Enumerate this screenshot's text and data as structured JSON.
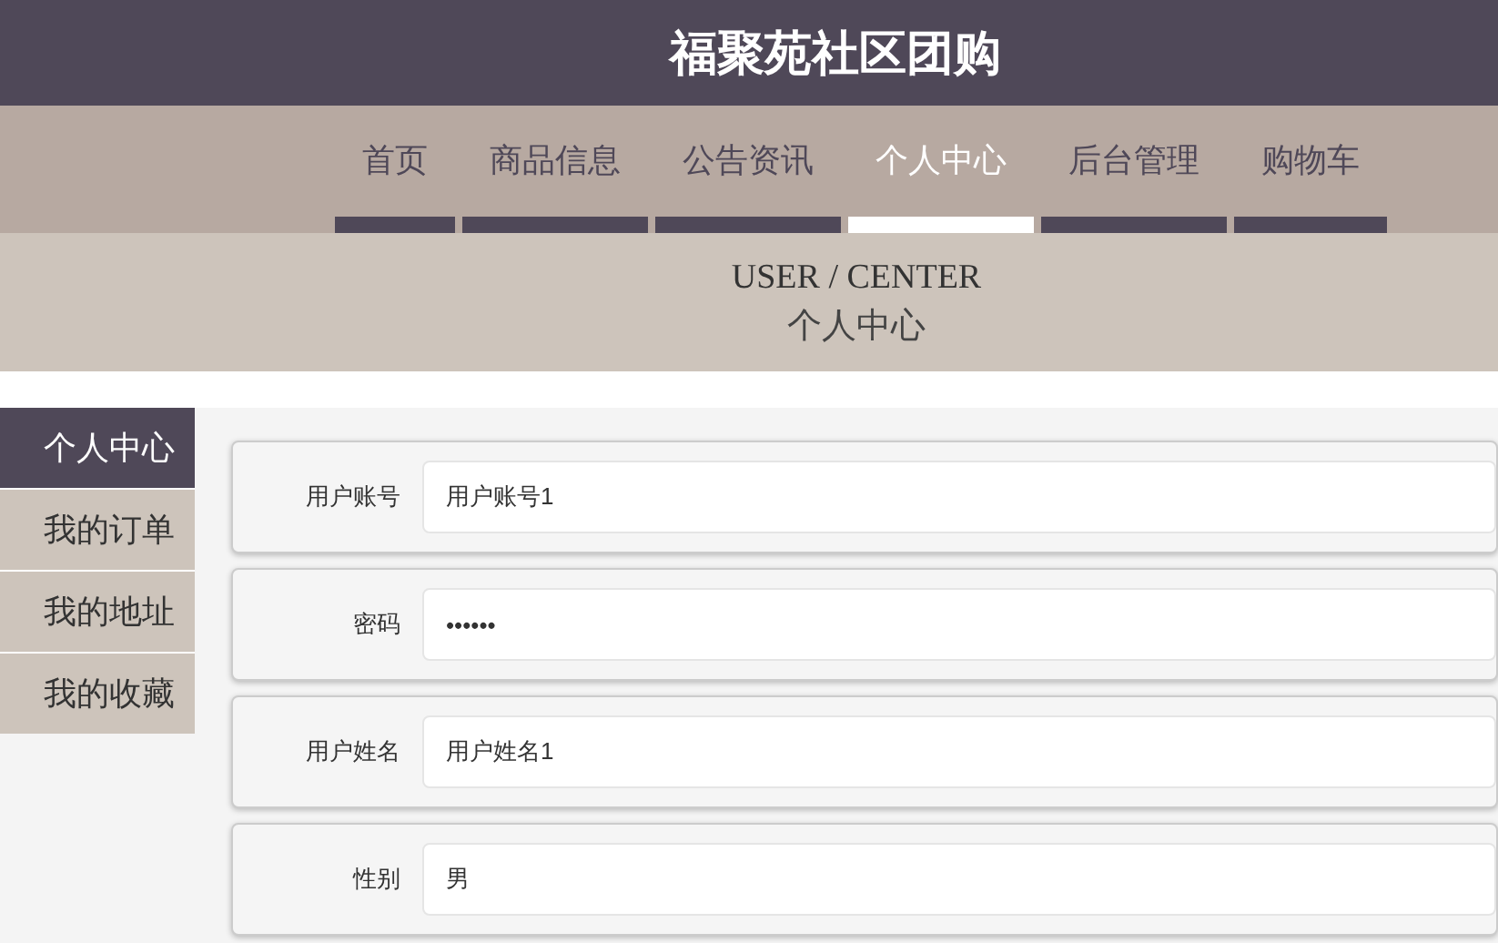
{
  "site_title": "福聚苑社区团购",
  "nav": [
    {
      "label": "首页",
      "selected": false
    },
    {
      "label": "商品信息",
      "selected": false
    },
    {
      "label": "公告资讯",
      "selected": false
    },
    {
      "label": "个人中心",
      "selected": true
    },
    {
      "label": "后台管理",
      "selected": false
    },
    {
      "label": "购物车",
      "selected": false
    }
  ],
  "banner": {
    "title": "USER / CENTER",
    "subtitle": "个人中心"
  },
  "sidebar": {
    "items": [
      {
        "label": "个人中心",
        "selected": true
      },
      {
        "label": "我的订单",
        "selected": false
      },
      {
        "label": "我的地址",
        "selected": false
      },
      {
        "label": "我的收藏",
        "selected": false
      }
    ]
  },
  "form": {
    "fields": [
      {
        "label": "用户账号",
        "value": "用户账号1"
      },
      {
        "label": "密码",
        "value": "••••••"
      },
      {
        "label": "用户姓名",
        "value": "用户姓名1"
      },
      {
        "label": "性别",
        "value": "男"
      }
    ]
  }
}
